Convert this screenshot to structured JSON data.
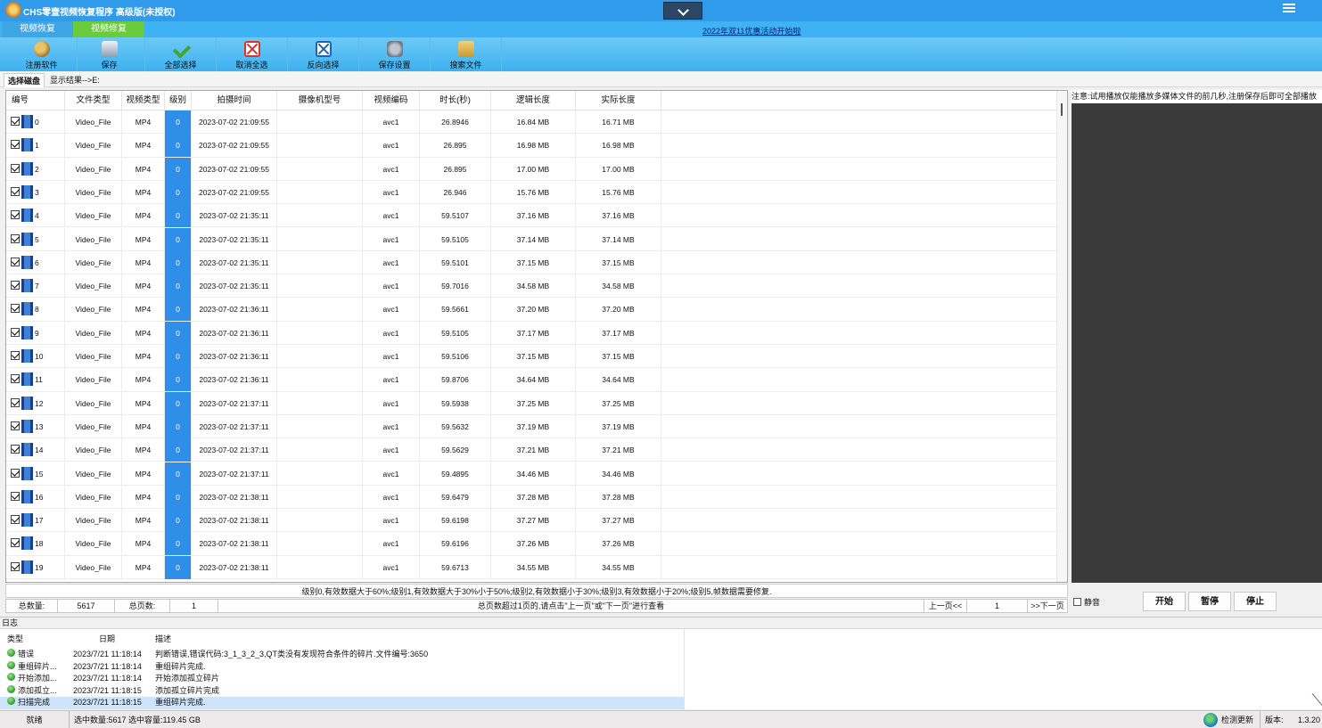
{
  "window": {
    "title": "CHS零壹视频恢复程序 高级版(未授权)",
    "promo_link": "2022年双11优惠活动开始啦"
  },
  "nav_tabs": [
    {
      "label": "视频恢复",
      "active": false
    },
    {
      "label": "视频修复",
      "active": true
    }
  ],
  "toolbar": [
    {
      "label": "注册软件",
      "icon": "key-icon"
    },
    {
      "label": "保存",
      "icon": "save-icon"
    },
    {
      "label": "全部选择",
      "icon": "checkmark-icon"
    },
    {
      "label": "取消全选",
      "icon": "uncheck-all-icon"
    },
    {
      "label": "反向选择",
      "icon": "invert-selection-icon"
    },
    {
      "label": "保存设置",
      "icon": "settings-icon"
    },
    {
      "label": "搜索文件",
      "icon": "search-file-icon"
    }
  ],
  "subtabs": {
    "select_disk": "选择磁盘",
    "show_result": "显示结果-->E:"
  },
  "table": {
    "columns": [
      "编号",
      "文件类型",
      "视频类型",
      "级别",
      "拍摄时间",
      "摄像机型号",
      "视频编码",
      "时长(秒)",
      "逻辑长度",
      "实际长度"
    ],
    "rows": [
      {
        "id": "0",
        "file_type": "Video_File",
        "video_type": "MP4",
        "level": "0",
        "time": "2023-07-02 21:09:55",
        "camera": "",
        "codec": "avc1",
        "duration": "26.8946",
        "logical": "16.84 MB",
        "actual": "16.71 MB"
      },
      {
        "id": "1",
        "file_type": "Video_File",
        "video_type": "MP4",
        "level": "0",
        "time": "2023-07-02 21:09:55",
        "camera": "",
        "codec": "avc1",
        "duration": "26.895",
        "logical": "16.98 MB",
        "actual": "16.98 MB"
      },
      {
        "id": "2",
        "file_type": "Video_File",
        "video_type": "MP4",
        "level": "0",
        "time": "2023-07-02 21:09:55",
        "camera": "",
        "codec": "avc1",
        "duration": "26.895",
        "logical": "17.00 MB",
        "actual": "17.00 MB"
      },
      {
        "id": "3",
        "file_type": "Video_File",
        "video_type": "MP4",
        "level": "0",
        "time": "2023-07-02 21:09:55",
        "camera": "",
        "codec": "avc1",
        "duration": "26.946",
        "logical": "15.76 MB",
        "actual": "15.76 MB"
      },
      {
        "id": "4",
        "file_type": "Video_File",
        "video_type": "MP4",
        "level": "0",
        "time": "2023-07-02 21:35:11",
        "camera": "",
        "codec": "avc1",
        "duration": "59.5107",
        "logical": "37.16 MB",
        "actual": "37.16 MB"
      },
      {
        "id": "5",
        "file_type": "Video_File",
        "video_type": "MP4",
        "level": "0",
        "time": "2023-07-02 21:35:11",
        "camera": "",
        "codec": "avc1",
        "duration": "59.5105",
        "logical": "37.14 MB",
        "actual": "37.14 MB"
      },
      {
        "id": "6",
        "file_type": "Video_File",
        "video_type": "MP4",
        "level": "0",
        "time": "2023-07-02 21:35:11",
        "camera": "",
        "codec": "avc1",
        "duration": "59.5101",
        "logical": "37.15 MB",
        "actual": "37.15 MB"
      },
      {
        "id": "7",
        "file_type": "Video_File",
        "video_type": "MP4",
        "level": "0",
        "time": "2023-07-02 21:35:11",
        "camera": "",
        "codec": "avc1",
        "duration": "59.7016",
        "logical": "34.58 MB",
        "actual": "34.58 MB"
      },
      {
        "id": "8",
        "file_type": "Video_File",
        "video_type": "MP4",
        "level": "0",
        "time": "2023-07-02 21:36:11",
        "camera": "",
        "codec": "avc1",
        "duration": "59.5661",
        "logical": "37.20 MB",
        "actual": "37.20 MB"
      },
      {
        "id": "9",
        "file_type": "Video_File",
        "video_type": "MP4",
        "level": "0",
        "time": "2023-07-02 21:36:11",
        "camera": "",
        "codec": "avc1",
        "duration": "59.5105",
        "logical": "37.17 MB",
        "actual": "37.17 MB"
      },
      {
        "id": "10",
        "file_type": "Video_File",
        "video_type": "MP4",
        "level": "0",
        "time": "2023-07-02 21:36:11",
        "camera": "",
        "codec": "avc1",
        "duration": "59.5106",
        "logical": "37.15 MB",
        "actual": "37.15 MB"
      },
      {
        "id": "11",
        "file_type": "Video_File",
        "video_type": "MP4",
        "level": "0",
        "time": "2023-07-02 21:36:11",
        "camera": "",
        "codec": "avc1",
        "duration": "59.8706",
        "logical": "34.64 MB",
        "actual": "34.64 MB"
      },
      {
        "id": "12",
        "file_type": "Video_File",
        "video_type": "MP4",
        "level": "0",
        "time": "2023-07-02 21:37:11",
        "camera": "",
        "codec": "avc1",
        "duration": "59.5938",
        "logical": "37.25 MB",
        "actual": "37.25 MB"
      },
      {
        "id": "13",
        "file_type": "Video_File",
        "video_type": "MP4",
        "level": "0",
        "time": "2023-07-02 21:37:11",
        "camera": "",
        "codec": "avc1",
        "duration": "59.5632",
        "logical": "37.19 MB",
        "actual": "37.19 MB"
      },
      {
        "id": "14",
        "file_type": "Video_File",
        "video_type": "MP4",
        "level": "0",
        "time": "2023-07-02 21:37:11",
        "camera": "",
        "codec": "avc1",
        "duration": "59.5629",
        "logical": "37.21 MB",
        "actual": "37.21 MB"
      },
      {
        "id": "15",
        "file_type": "Video_File",
        "video_type": "MP4",
        "level": "0",
        "time": "2023-07-02 21:37:11",
        "camera": "",
        "codec": "avc1",
        "duration": "59.4895",
        "logical": "34.46 MB",
        "actual": "34.46 MB"
      },
      {
        "id": "16",
        "file_type": "Video_File",
        "video_type": "MP4",
        "level": "0",
        "time": "2023-07-02 21:38:11",
        "camera": "",
        "codec": "avc1",
        "duration": "59.6479",
        "logical": "37.28 MB",
        "actual": "37.28 MB"
      },
      {
        "id": "17",
        "file_type": "Video_File",
        "video_type": "MP4",
        "level": "0",
        "time": "2023-07-02 21:38:11",
        "camera": "",
        "codec": "avc1",
        "duration": "59.6198",
        "logical": "37.27 MB",
        "actual": "37.27 MB"
      },
      {
        "id": "18",
        "file_type": "Video_File",
        "video_type": "MP4",
        "level": "0",
        "time": "2023-07-02 21:38:11",
        "camera": "",
        "codec": "avc1",
        "duration": "59.6196",
        "logical": "37.26 MB",
        "actual": "37.26 MB"
      },
      {
        "id": "19",
        "file_type": "Video_File",
        "video_type": "MP4",
        "level": "0",
        "time": "2023-07-02 21:38:11",
        "camera": "",
        "codec": "avc1",
        "duration": "59.6713",
        "logical": "34.55 MB",
        "actual": "34.55 MB"
      }
    ]
  },
  "level_note": "级别0,有效数据大于60%;级别1,有效数据大于30%小于50%;级别2,有效数据小于30%;级别3,有效数据小于20%;级别5,帧数据需要修复.",
  "pager": {
    "total_label": "总数量:",
    "total_value": "5617",
    "pages_label": "总页数:",
    "pages_value": "1",
    "hint": "总页数超过1页的,请点击\"上一页\"或\"下一页\"进行查看",
    "prev": "上一页<<",
    "current_page": "1",
    "next": ">>下一页"
  },
  "preview": {
    "note": "注意:试用播放仅能播放多媒体文件的前几秒,注册保存后即可全部播放",
    "mute_label": "静音",
    "start": "开始",
    "pause": "暂停",
    "stop": "停止"
  },
  "log": {
    "title": "日志",
    "columns": [
      "类型",
      "日期",
      "描述"
    ],
    "rows": [
      {
        "type": "错误",
        "date": "2023/7/21 11:18:14",
        "desc": "判断错误,错误代码:3_1_3_2_3,QT类没有发现符合条件的碎片.文件编号:3650"
      },
      {
        "type": "重组碎片...",
        "date": "2023/7/21 11:18:14",
        "desc": "重组碎片完成."
      },
      {
        "type": "开始添加...",
        "date": "2023/7/21 11:18:14",
        "desc": "开始添加孤立碎片"
      },
      {
        "type": "添加孤立...",
        "date": "2023/7/21 11:18:15",
        "desc": "添加孤立碎片完成"
      },
      {
        "type": "扫描完成",
        "date": "2023/7/21 11:18:15",
        "desc": "重组碎片完成."
      }
    ]
  },
  "status": {
    "ready": "就绪",
    "selection": "选中数量:5617 选中容量:119.45 GB",
    "update": "检测更新",
    "version_label": "版本:",
    "version": "1.3.20"
  },
  "colors": {
    "titlebar": "#2f9bea",
    "toolbar": "#3eb0ef",
    "level_cell": "#2f8fe8",
    "active_tab": "#6acb3c"
  }
}
